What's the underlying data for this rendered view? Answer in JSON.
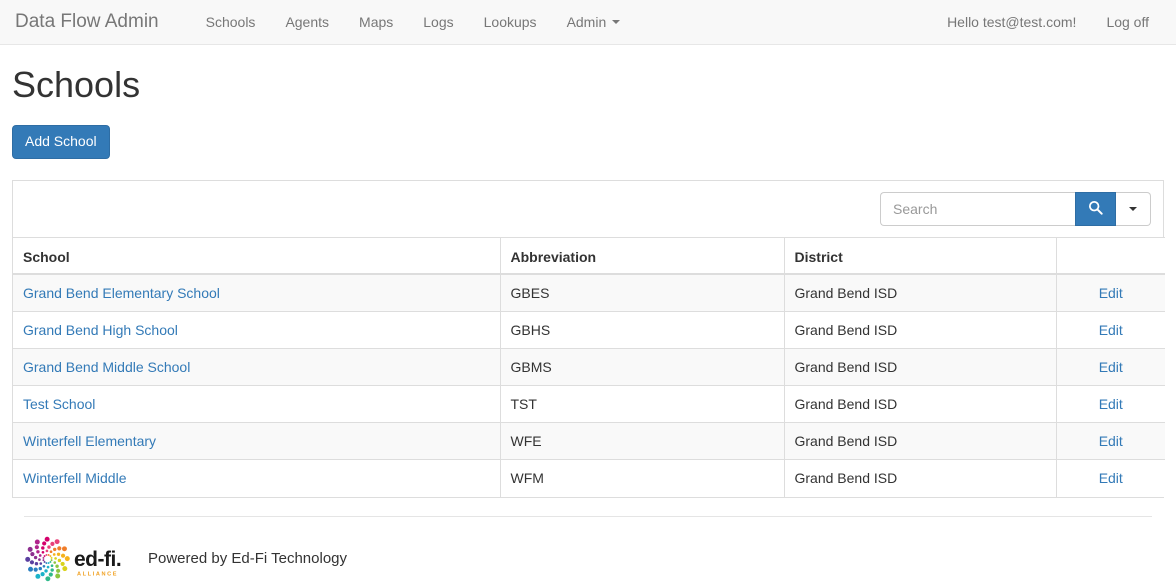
{
  "navbar": {
    "brand": "Data Flow Admin",
    "left_items": [
      {
        "label": "Schools",
        "name": "nav-schools",
        "has_caret": false
      },
      {
        "label": "Agents",
        "name": "nav-agents",
        "has_caret": false
      },
      {
        "label": "Maps",
        "name": "nav-maps",
        "has_caret": false
      },
      {
        "label": "Logs",
        "name": "nav-logs",
        "has_caret": false
      },
      {
        "label": "Lookups",
        "name": "nav-lookups",
        "has_caret": false
      },
      {
        "label": "Admin",
        "name": "nav-admin",
        "has_caret": true
      }
    ],
    "greeting": "Hello test@test.com!",
    "logoff": "Log off"
  },
  "page": {
    "title": "Schools",
    "add_button": "Add School"
  },
  "search": {
    "placeholder": "Search",
    "value": "",
    "search_icon": "search-icon",
    "dropdown_icon": "chevron-down-icon"
  },
  "table": {
    "columns": [
      "School",
      "Abbreviation",
      "District",
      ""
    ],
    "rows": [
      {
        "school": "Grand Bend Elementary School",
        "abbreviation": "GBES",
        "district": "Grand Bend ISD",
        "action": "Edit"
      },
      {
        "school": "Grand Bend High School",
        "abbreviation": "GBHS",
        "district": "Grand Bend ISD",
        "action": "Edit"
      },
      {
        "school": "Grand Bend Middle School",
        "abbreviation": "GBMS",
        "district": "Grand Bend ISD",
        "action": "Edit"
      },
      {
        "school": "Test School",
        "abbreviation": "TST",
        "district": "Grand Bend ISD",
        "action": "Edit"
      },
      {
        "school": "Winterfell Elementary",
        "abbreviation": "WFE",
        "district": "Grand Bend ISD",
        "action": "Edit"
      },
      {
        "school": "Winterfell Middle",
        "abbreviation": "WFM",
        "district": "Grand Bend ISD",
        "action": "Edit"
      }
    ]
  },
  "footer": {
    "text": "Powered by Ed-Fi Technology",
    "logo_wordmark": "ed-fi.",
    "logo_subtext": "ALLIANCE"
  },
  "colors": {
    "primary": "#337ab7",
    "primary_border": "#2e6da4",
    "link": "#337ab7",
    "navbar_bg": "#f8f8f8",
    "navbar_border": "#e7e7e7",
    "text": "#333333",
    "muted": "#777777",
    "table_border": "#dddddd",
    "stripe": "#f9f9f9"
  }
}
